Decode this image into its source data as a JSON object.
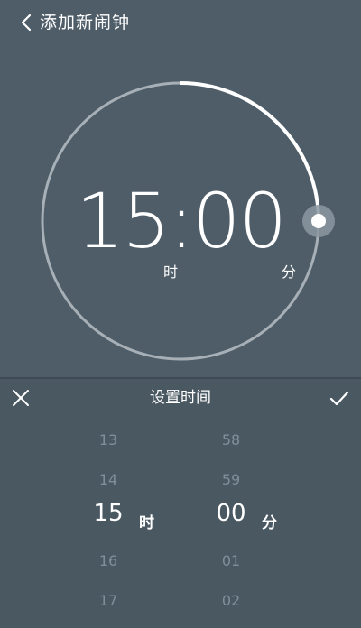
{
  "header": {
    "title": "添加新闹钟",
    "back_icon": "chevron-left-icon"
  },
  "clock": {
    "time": "15:00",
    "hour_unit": "时",
    "minute_unit": "分",
    "progress_fraction": 0.25
  },
  "panel": {
    "title": "设置时间",
    "close_icon": "close-icon",
    "confirm_icon": "check-icon"
  },
  "picker": {
    "hours": [
      "13",
      "14",
      "15",
      "16",
      "17"
    ],
    "minutes": [
      "58",
      "59",
      "00",
      "01",
      "02"
    ],
    "selected_index": 2,
    "hour_unit": "时",
    "minute_unit": "分"
  },
  "colors": {
    "background": "#4a5862",
    "ring": "#a7b0b7",
    "accent": "#ffffff",
    "inactive_text": "#7f8e99"
  }
}
